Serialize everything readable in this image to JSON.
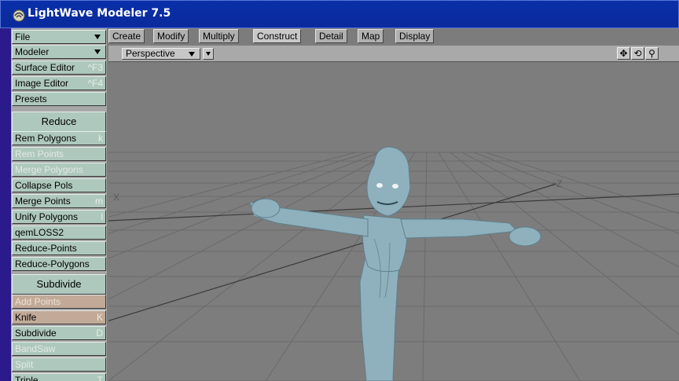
{
  "app": {
    "title": "LightWave Modeler 7.5"
  },
  "tabs": [
    {
      "label": "Create"
    },
    {
      "label": "Modify"
    },
    {
      "label": "Multiply"
    },
    {
      "label": "Construct"
    },
    {
      "label": "Detail"
    },
    {
      "label": "Map"
    },
    {
      "label": "Display"
    }
  ],
  "sidebar": {
    "file": "File",
    "modeler": "Modeler",
    "surface_editor": {
      "label": "Surface Editor",
      "key": "^F3"
    },
    "image_editor": {
      "label": "Image Editor",
      "key": "^F4"
    },
    "presets": "Presets",
    "reduce_header": "Reduce",
    "reduce_items": [
      {
        "label": "Rem Polygons",
        "key": "k"
      },
      {
        "label": "Rem Points",
        "key": ""
      },
      {
        "label": "Merge Polygons",
        "key": ""
      },
      {
        "label": "Collapse Pols",
        "key": ""
      },
      {
        "label": "Merge Points",
        "key": "m"
      },
      {
        "label": "Unify Polygons",
        "key": "l"
      },
      {
        "label": "qemLOSS2",
        "key": ""
      },
      {
        "label": "Reduce-Points",
        "key": ""
      },
      {
        "label": "Reduce-Polygons",
        "key": ""
      }
    ],
    "subdivide_header": "Subdivide",
    "subdivide_items": [
      {
        "label": "Add Points",
        "key": ""
      },
      {
        "label": "Knife",
        "key": "K"
      },
      {
        "label": "Subdivide",
        "key": "D"
      },
      {
        "label": "BandSaw",
        "key": ""
      },
      {
        "label": "Split",
        "key": ""
      },
      {
        "label": "Triple",
        "key": "T"
      }
    ]
  },
  "viewport": {
    "view_mode": "Perspective",
    "axis_x": "X",
    "axis_z": "+Z",
    "move_icon": "✥",
    "rotate_icon": "⟲",
    "zoom_icon": "⚲"
  }
}
